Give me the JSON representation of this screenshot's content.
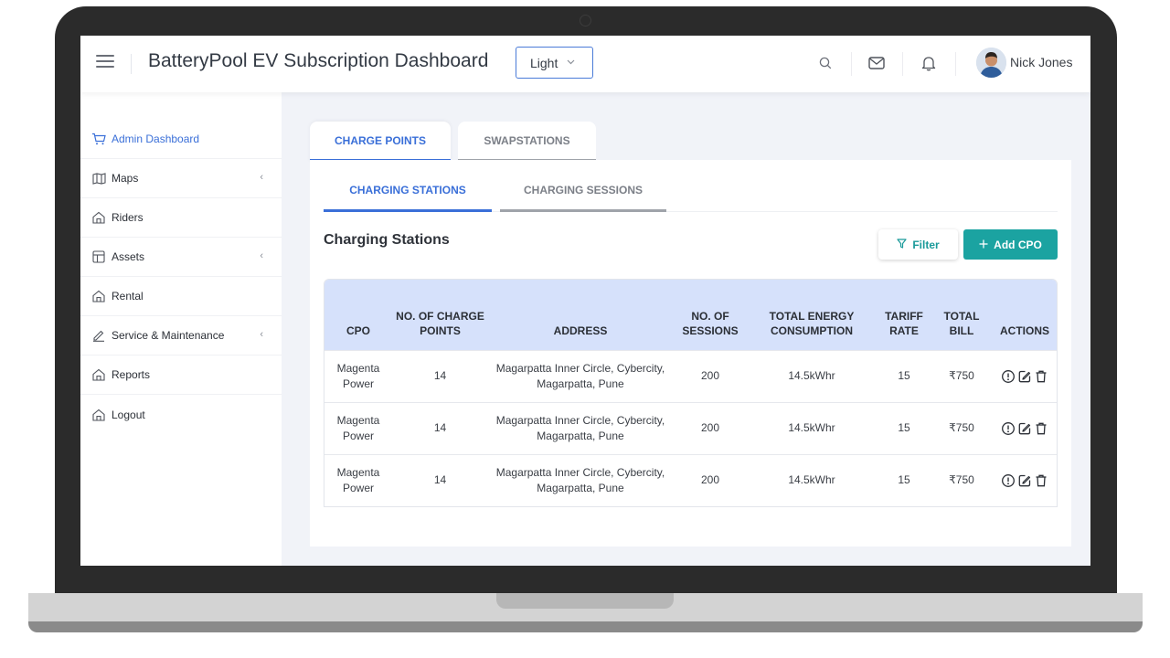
{
  "app": {
    "title": "BatteryPool EV Subscription Dashboard"
  },
  "theme_select": {
    "value": "Light"
  },
  "user": {
    "name": "Nick Jones"
  },
  "sidebar": {
    "items": [
      {
        "label": "Admin Dashboard",
        "icon": "cart-icon",
        "active": true,
        "has_submenu": false
      },
      {
        "label": "Maps",
        "icon": "map-icon",
        "active": false,
        "has_submenu": true
      },
      {
        "label": "Riders",
        "icon": "home-icon",
        "active": false,
        "has_submenu": false
      },
      {
        "label": "Assets",
        "icon": "layout-icon",
        "active": false,
        "has_submenu": true
      },
      {
        "label": "Rental",
        "icon": "home-icon",
        "active": false,
        "has_submenu": false
      },
      {
        "label": "Service & Maintenance",
        "icon": "pencil-icon",
        "active": false,
        "has_submenu": true
      },
      {
        "label": "Reports",
        "icon": "home-icon",
        "active": false,
        "has_submenu": false
      },
      {
        "label": "Logout",
        "icon": "home-icon",
        "active": false,
        "has_submenu": false
      }
    ]
  },
  "outer_tabs": [
    {
      "label": "CHARGE POINTS",
      "active": true
    },
    {
      "label": "SWAPSTATIONS",
      "active": false
    }
  ],
  "inner_tabs": [
    {
      "label": "CHARGING STATIONS",
      "active": true
    },
    {
      "label": "CHARGING SESSIONS",
      "active": false
    }
  ],
  "section": {
    "title": "Charging Stations",
    "filter_label": "Filter",
    "add_label": "Add CPO"
  },
  "table": {
    "headers": [
      "CPO",
      "NO. OF CHARGE POINTS",
      "ADDRESS",
      "NO. OF SESSIONS",
      "TOTAL ENERGY CONSUMPTION",
      "TARIFF RATE",
      "TOTAL BILL",
      "ACTIONS"
    ],
    "rows": [
      [
        "Magenta Power",
        "14",
        "Magarpatta Inner Circle, Cybercity, Magarpatta, Pune",
        "200",
        "14.5kWhr",
        "15",
        "₹750"
      ],
      [
        "Magenta Power",
        "14",
        "Magarpatta Inner Circle, Cybercity, Magarpatta, Pune",
        "200",
        "14.5kWhr",
        "15",
        "₹750"
      ],
      [
        "Magenta Power",
        "14",
        "Magarpatta Inner Circle, Cybercity, Magarpatta, Pune",
        "200",
        "14.5kWhr",
        "15",
        "₹750"
      ]
    ],
    "row_action_icons": [
      "info-icon",
      "edit-icon",
      "trash-icon"
    ]
  },
  "colors": {
    "accent_blue": "#3a6fd8",
    "teal": "#1ba3a1",
    "table_header_bg": "#d6e1fb",
    "page_bg": "#f1f3f8"
  }
}
